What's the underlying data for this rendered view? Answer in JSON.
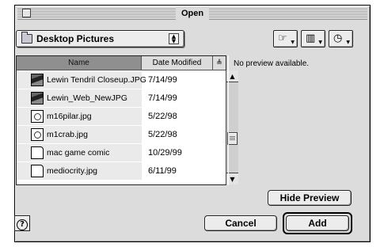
{
  "window": {
    "title": "Open"
  },
  "folder_popup": {
    "label": "Desktop Pictures"
  },
  "toolbar": {
    "shortcuts_glyph": "☞",
    "favorites_glyph": "▥",
    "recent_glyph": "◷"
  },
  "list": {
    "columns": [
      "Name",
      "Date Modified"
    ],
    "sort_glyph": "≜",
    "rows": [
      {
        "name": "Lewin Tendril Closeup.JPG",
        "date": "7/14/99",
        "icon": "picture-icon"
      },
      {
        "name": "Lewin_Web_NewJPG",
        "date": "7/14/99",
        "icon": "picture-icon"
      },
      {
        "name": "m16pilar.jpg",
        "date": "5/22/98",
        "icon": "jpeg-file-icon"
      },
      {
        "name": "m1crab.jpg",
        "date": "5/22/98",
        "icon": "jpeg-file-icon"
      },
      {
        "name": "mac game comic",
        "date": "10/29/99",
        "icon": "document-icon"
      },
      {
        "name": "mediocrity.jpg",
        "date": "6/11/99",
        "icon": "document-icon"
      }
    ]
  },
  "preview": {
    "text": "No preview available."
  },
  "buttons": {
    "hide_preview": "Hide Preview",
    "cancel": "Cancel",
    "add": "Add",
    "help": "?"
  }
}
